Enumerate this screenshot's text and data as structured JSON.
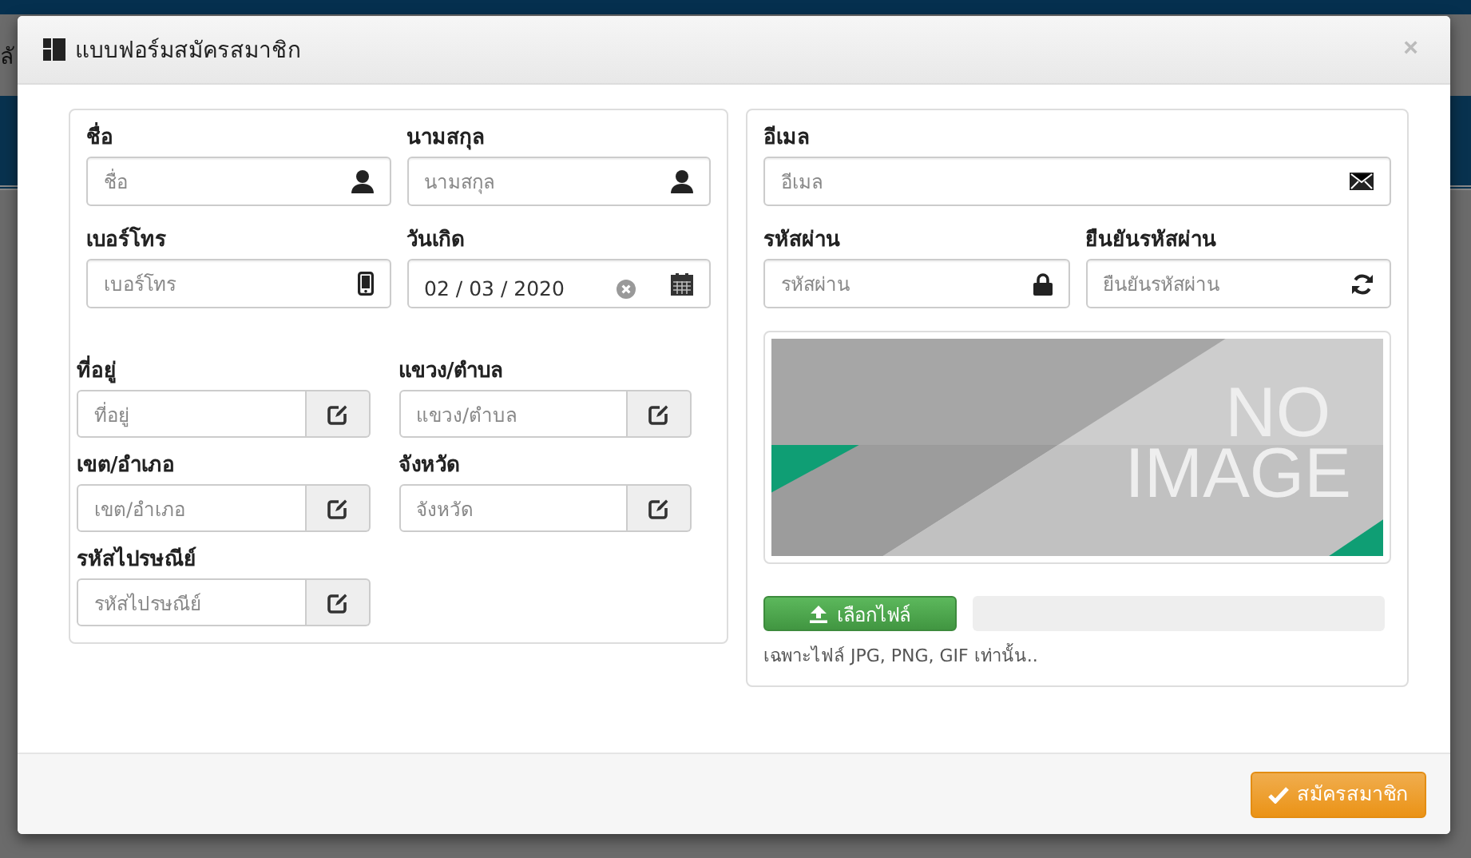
{
  "backdrop": {
    "text": "ลั"
  },
  "modal": {
    "title": "แบบฟอร์มสมัครสมาชิก",
    "close": "×"
  },
  "personal": [
    {
      "label": "ชื่อ",
      "placeholder": "ชื่อ",
      "kind": "person"
    },
    {
      "label": "นามสกุล",
      "placeholder": "นามสกุล",
      "kind": "person"
    },
    {
      "label": "เบอร์โทร",
      "placeholder": "เบอร์โทร",
      "kind": "phone"
    },
    {
      "label": "วันเกิด",
      "value": "02 / 03 / 2020",
      "kind": "date"
    }
  ],
  "address": [
    {
      "label": "ที่อยู่",
      "placeholder": "ที่อยู่"
    },
    {
      "label": "แขวง/ตำบล",
      "placeholder": "แขวง/ตำบล"
    },
    {
      "label": "เขต/อำเภอ",
      "placeholder": "เขต/อำเภอ"
    },
    {
      "label": "จังหวัด",
      "placeholder": "จังหวัด"
    },
    {
      "label": "รหัสไปรษณีย์",
      "placeholder": "รหัสไปรษณีย์"
    }
  ],
  "account": [
    {
      "label": "อีเมล",
      "placeholder": "อีเมล",
      "kind": "email"
    },
    {
      "label": "รหัสผ่าน",
      "placeholder": "รหัสผ่าน",
      "kind": "password"
    },
    {
      "label": "ยืนยันรหัสผ่าน",
      "placeholder": "ยืนยันรหัสผ่าน",
      "kind": "confirm"
    }
  ],
  "preview": {
    "text_lines": [
      "NO",
      "IMAGE"
    ]
  },
  "upload": {
    "button": "เลือกไฟล์",
    "hint": "เฉพาะไฟล์ JPG, PNG, GIF เท่านั้น.."
  },
  "submit": "สมัครสมาชิก"
}
